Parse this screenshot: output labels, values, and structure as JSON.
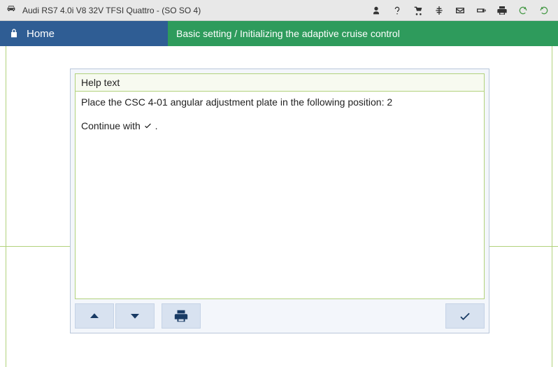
{
  "vehicle_title": "Audi RS7 4.0i V8 32V TFSI Quattro - (SO SO 4)",
  "nav": {
    "home_label": "Home",
    "breadcrumb": "Basic setting / Initializing the adaptive cruise control"
  },
  "help": {
    "header": "Help text",
    "line1": "Place the CSC 4-01 angular adjustment plate in the following position: 2",
    "continue_prefix": "Continue with ",
    "continue_suffix": " ."
  },
  "toolbar_icons": [
    "person-icon",
    "help-icon",
    "cart-icon",
    "tree-icon",
    "mail-icon",
    "battery-icon",
    "print-icon",
    "refresh-left-icon",
    "refresh-right-icon"
  ]
}
